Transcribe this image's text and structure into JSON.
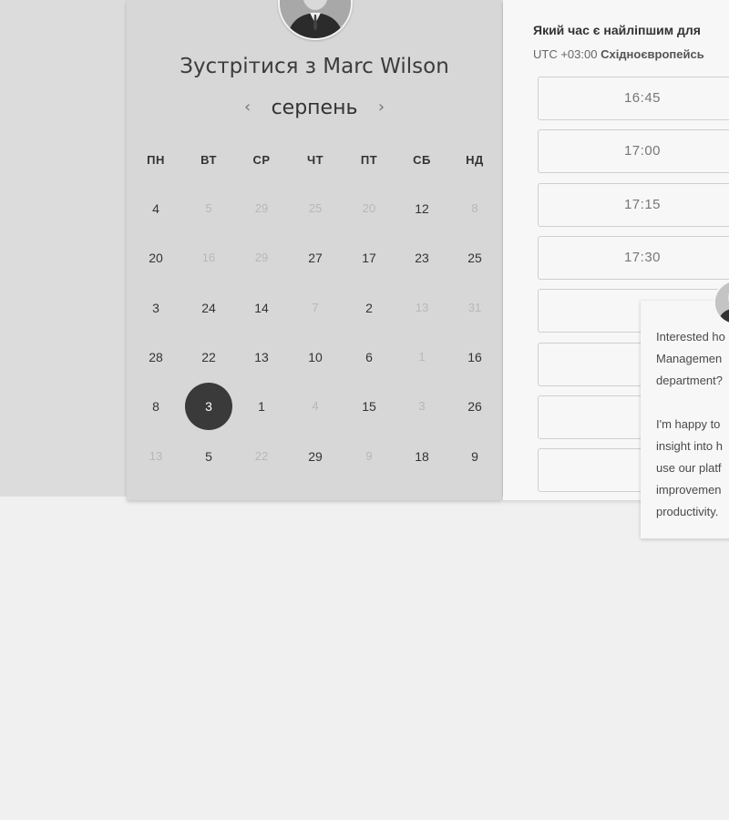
{
  "calendar": {
    "title": "Зустрітися з Marc Wilson",
    "month": "серпень",
    "prev_arrow": "‹",
    "next_arrow": "›",
    "weekdays": [
      "ПН",
      "ВТ",
      "СР",
      "ЧТ",
      "ПТ",
      "СБ",
      "НД"
    ],
    "weeks": [
      [
        {
          "d": "4",
          "m": false
        },
        {
          "d": "5",
          "m": true
        },
        {
          "d": "29",
          "m": true
        },
        {
          "d": "25",
          "m": true
        },
        {
          "d": "20",
          "m": true
        },
        {
          "d": "12",
          "m": false
        },
        {
          "d": "8",
          "m": true
        }
      ],
      [
        {
          "d": "20",
          "m": false
        },
        {
          "d": "16",
          "m": true
        },
        {
          "d": "29",
          "m": true
        },
        {
          "d": "27",
          "m": false
        },
        {
          "d": "17",
          "m": false
        },
        {
          "d": "23",
          "m": false
        },
        {
          "d": "25",
          "m": false
        }
      ],
      [
        {
          "d": "3",
          "m": false
        },
        {
          "d": "24",
          "m": false
        },
        {
          "d": "14",
          "m": false
        },
        {
          "d": "7",
          "m": true
        },
        {
          "d": "2",
          "m": false
        },
        {
          "d": "13",
          "m": true
        },
        {
          "d": "31",
          "m": true
        }
      ],
      [
        {
          "d": "28",
          "m": false
        },
        {
          "d": "22",
          "m": false
        },
        {
          "d": "13",
          "m": false
        },
        {
          "d": "10",
          "m": false
        },
        {
          "d": "6",
          "m": false
        },
        {
          "d": "1",
          "m": true
        },
        {
          "d": "16",
          "m": false
        }
      ],
      [
        {
          "d": "8",
          "m": false
        },
        {
          "d": "3",
          "m": false,
          "selected": true
        },
        {
          "d": "1",
          "m": false
        },
        {
          "d": "4",
          "m": true
        },
        {
          "d": "15",
          "m": false
        },
        {
          "d": "3",
          "m": true
        },
        {
          "d": "26",
          "m": false
        }
      ],
      [
        {
          "d": "13",
          "m": true
        },
        {
          "d": "5",
          "m": false
        },
        {
          "d": "22",
          "m": true
        },
        {
          "d": "29",
          "m": false
        },
        {
          "d": "9",
          "m": true
        },
        {
          "d": "18",
          "m": false
        },
        {
          "d": "9",
          "m": false
        }
      ]
    ]
  },
  "times": {
    "heading": "Який час є найліпшим для",
    "timezone_offset": "UTC +03:00",
    "timezone_name": "Східноєвропейсь",
    "slots": [
      "16:45",
      "17:00",
      "17:15",
      "17:30",
      "",
      "",
      "",
      ""
    ]
  },
  "popup": {
    "text": "Interested ho\nManagemen\ndepartment?\n\nI'm happy to\ninsight into h\nuse our platf\nimprovemen\nproductivity."
  },
  "colors": {
    "selected_day": "#3a3a3a",
    "panel_bg": "#d7d7d7",
    "time_panel_bg": "#f7f7f7"
  }
}
